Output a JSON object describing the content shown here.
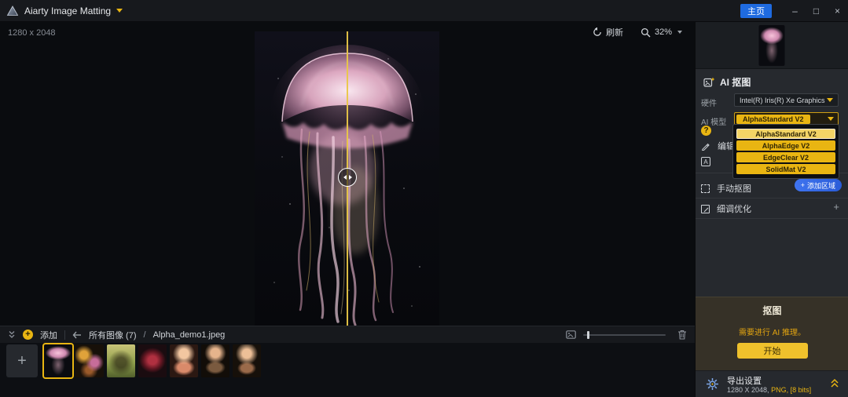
{
  "title_bar": {
    "app_title": "Aiarty Image Matting",
    "home_button_label": "主页",
    "minimize_icon": "–",
    "maximize_icon": "□",
    "close_icon": "×"
  },
  "canvas": {
    "image_dimensions": "1280 x 2048",
    "reset_label": "刷新",
    "zoom_value": "32%"
  },
  "right_panel": {
    "ai_section_title": "AI 抠图",
    "hardware_label": "硬件",
    "hardware_value": "Intel(R) Iris(R) Xe Graphics",
    "ai_model_label": "AI 模型",
    "ai_model_value": "AlphaStandard V2",
    "ai_model_options": [
      "AlphaStandard V2",
      "AlphaEdge V2",
      "EdgeClear V2",
      "SolidMat V2"
    ],
    "help_icon_glyph": "?",
    "edit_label": "编辑",
    "manual_matting_label": "手动抠图",
    "add_region_plus_glyph": "+",
    "add_region_label": "添加区域",
    "fine_tune_label": "细调优化",
    "fine_tune_expand_glyph": "+",
    "matting_box": {
      "title": "抠图",
      "message": "需要进行 AI 推理。",
      "start_label": "开始"
    },
    "export": {
      "label": "导出设置",
      "size_text": "1280 X 2048,",
      "format_text": "PNG, [8 bits]"
    }
  },
  "bottom_bar": {
    "add_plus_glyph": "+",
    "add_label": "添加",
    "breadcrumb_root": "所有图像 (7)",
    "breadcrumb_separator": "/",
    "breadcrumb_file": "Alpha_demo1.jpeg"
  },
  "filmstrip": {
    "add_glyph": "+",
    "thumbnails": [
      "jellyfish",
      "flowers",
      "bicycle",
      "red-dress",
      "bouquet",
      "portrait-1",
      "portrait-2"
    ]
  }
}
